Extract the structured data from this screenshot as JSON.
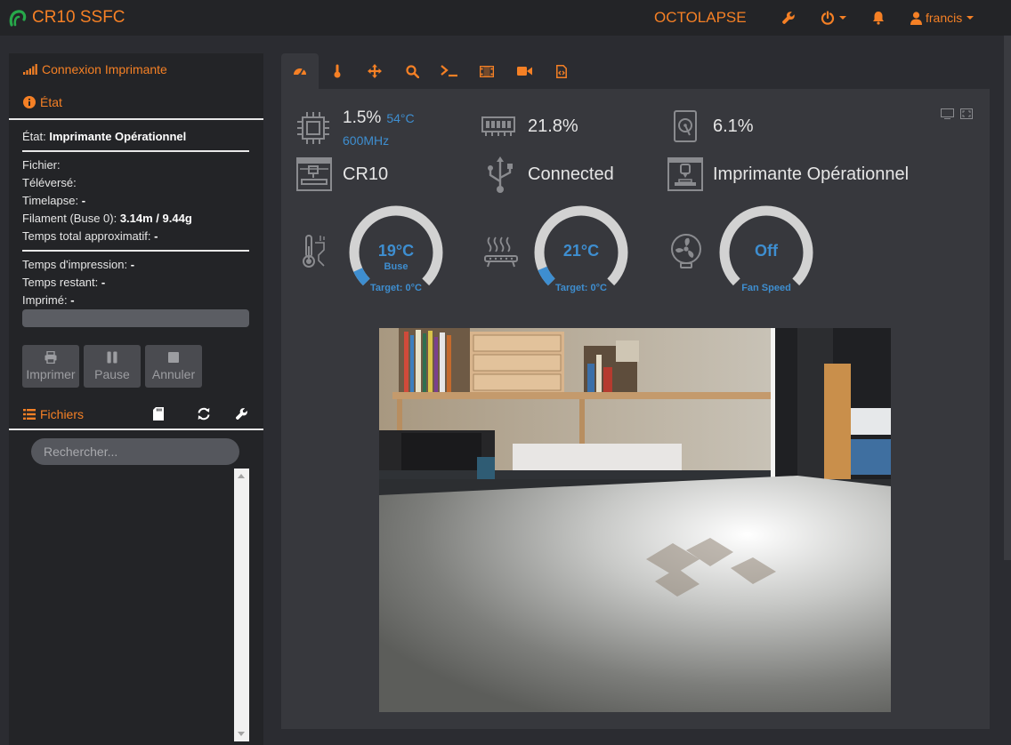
{
  "app": {
    "brand": "CR10 SSFC",
    "plugin_link": "OCTOLAPSE",
    "user": "francis"
  },
  "colors": {
    "accent": "#f58025",
    "info": "#3e8ed0",
    "background": "#2b2c31",
    "panel": "#232427",
    "gauge_track": "#d2d2d2"
  },
  "navbar": {
    "icons": [
      "wrench-icon",
      "power-icon",
      "bell-icon",
      "user-icon"
    ]
  },
  "sidebar": {
    "connection_title": "Connexion Imprimante",
    "state_title": "État",
    "state_label": "État:",
    "state_value": "Imprimante Opérationnel",
    "file_label": "Fichier:",
    "uploaded_label": "Téléversé:",
    "timelapse_label": "Timelapse:",
    "timelapse_value": "-",
    "filament_label": "Filament (Buse 0):",
    "filament_value": "3.14m / 9.44g",
    "total_time_label": "Temps total approximatif:",
    "total_time_value": "-",
    "print_time_label": "Temps d'impression:",
    "print_time_value": "-",
    "remaining_label": "Temps restant:",
    "remaining_value": "-",
    "printed_label": "Imprimé:",
    "printed_value": "-",
    "progress": 0,
    "buttons": {
      "print": "Imprimer",
      "pause": "Pause",
      "cancel": "Annuler"
    },
    "files_title": "Fichiers",
    "search_placeholder": "Rechercher..."
  },
  "tabs": [
    "dashboard-icon",
    "thermometer-icon",
    "move-icon",
    "search-icon",
    "terminal-icon",
    "film-icon",
    "video-icon",
    "file-code-icon"
  ],
  "dashboard": {
    "cpu_percent": "1.5%",
    "cpu_temp": "54°C",
    "cpu_freq": "600MHz",
    "ram": "21.8%",
    "disk": "6.1%",
    "printer_name": "CR10",
    "connection": "Connected",
    "printer_state": "Imprimante Opérationnel",
    "gauges": [
      {
        "value": "19°C",
        "sub": "Buse",
        "target": "Target: 0°C",
        "fraction": 0.076
      },
      {
        "value": "21°C",
        "sub": "",
        "target": "Target: 0°C",
        "fraction": 0.084
      },
      {
        "value": "Off",
        "sub": "",
        "target": "Fan Speed",
        "fraction": 0
      }
    ]
  }
}
